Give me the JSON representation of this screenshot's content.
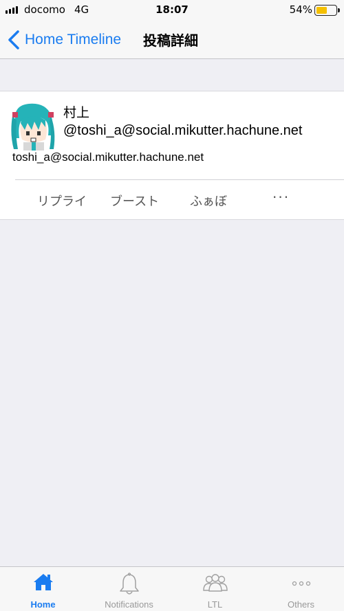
{
  "status_bar": {
    "carrier": "docomo",
    "network": "4G",
    "time": "18:07",
    "battery_percent": "54%",
    "battery_level": 0.54
  },
  "nav": {
    "back_label": "Home Timeline",
    "title": "投稿詳細"
  },
  "post": {
    "avatar_icon": "avatar-miku-icon",
    "display_name": "村上",
    "acct": "@toshi_a@social.mikutter.hachune.net",
    "content": "toshi_a@social.mikutter.hachune.net",
    "actions": {
      "reply": "リプライ",
      "boost": "ブースト",
      "favourite": "ふぁぼ",
      "more": "···"
    }
  },
  "tabs": [
    {
      "label": "Home",
      "icon": "home-icon",
      "active": true
    },
    {
      "label": "Notifications",
      "icon": "bell-icon",
      "active": false
    },
    {
      "label": "LTL",
      "icon": "people-icon",
      "active": false
    },
    {
      "label": "Others",
      "icon": "more-dots-icon",
      "active": false
    }
  ],
  "colors": {
    "accent": "#1a7cf0",
    "background": "#efeff4",
    "battery": "#f5c000"
  }
}
